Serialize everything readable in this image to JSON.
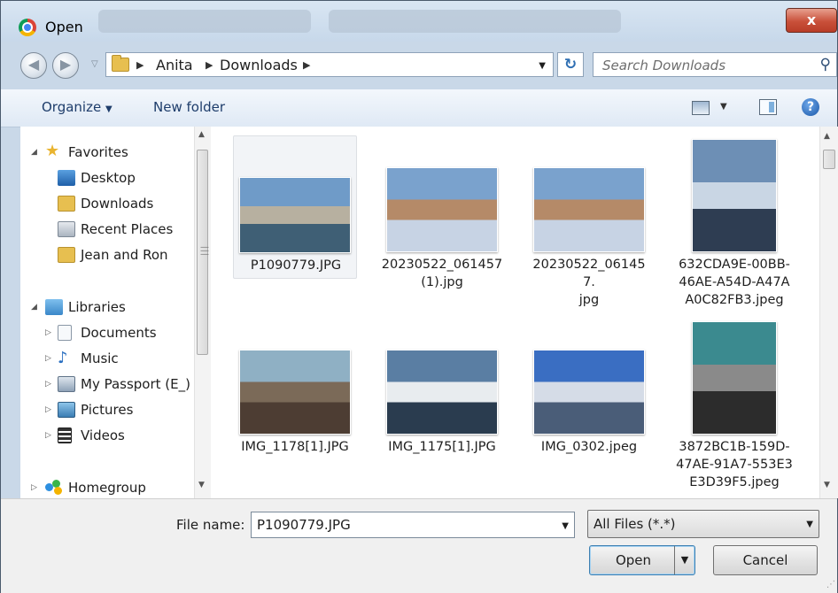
{
  "window": {
    "title": "Open",
    "close_glyph": "x"
  },
  "address": {
    "path": [
      "Anita",
      "Downloads"
    ]
  },
  "search": {
    "placeholder": "Search Downloads"
  },
  "toolbar": {
    "organize": "Organize",
    "new_folder": "New folder"
  },
  "nav": {
    "favorites": {
      "label": "Favorites",
      "items": [
        {
          "label": "Desktop",
          "icon": "desktop-icon"
        },
        {
          "label": "Downloads",
          "icon": "downloads-folder-icon"
        },
        {
          "label": "Recent Places",
          "icon": "recent-places-icon"
        },
        {
          "label": "Jean and Ron",
          "icon": "folder-icon"
        }
      ]
    },
    "libraries": {
      "label": "Libraries",
      "items": [
        {
          "label": "Documents",
          "icon": "documents-icon"
        },
        {
          "label": "Music",
          "icon": "music-icon"
        },
        {
          "label": "My Passport (E_)",
          "icon": "drive-icon"
        },
        {
          "label": "Pictures",
          "icon": "pictures-icon"
        },
        {
          "label": "Videos",
          "icon": "videos-icon"
        }
      ]
    },
    "homegroup": {
      "label": "Homegroup"
    }
  },
  "files": [
    {
      "name": "P1090779.JPG",
      "selected": true,
      "colors": [
        "#6f9bc8",
        "#b7b0a0",
        "#3f5f75"
      ]
    },
    {
      "name": "20230522_061457 (1).jpg",
      "colors": [
        "#7aa2cd",
        "#b58a68",
        "#c7d3e4"
      ]
    },
    {
      "name": "20230522_061457.jpg",
      "colors": [
        "#7aa2cd",
        "#b58a68",
        "#c7d3e4"
      ]
    },
    {
      "name": "632CDA9E-00BB-46AE-A54D-A47AA0C82FB3.jpeg",
      "colors": [
        "#6d8fb5",
        "#c9d6e4",
        "#2e3d52"
      ]
    },
    {
      "name": "IMG_1178[1].JPG",
      "colors": [
        "#8fb0c4",
        "#7b6a58",
        "#4d3d33"
      ]
    },
    {
      "name": "IMG_1175[1].JPG",
      "colors": [
        "#5a7ea3",
        "#e8ecef",
        "#2a3c4f"
      ]
    },
    {
      "name": "IMG_0302.jpeg",
      "colors": [
        "#3a6ec2",
        "#d5dce7",
        "#4a5d78"
      ]
    },
    {
      "name": "3872BC1B-159D-47AE-91A7-553E3E3D39F5.jpeg",
      "colors": [
        "#3b8a8f",
        "#8a8a8a",
        "#2c2c2c"
      ]
    }
  ],
  "footer": {
    "file_name_label": "File name:",
    "file_name_value": "P1090779.JPG",
    "filter": "All Files (*.*)",
    "open_label": "Open",
    "cancel_label": "Cancel"
  }
}
